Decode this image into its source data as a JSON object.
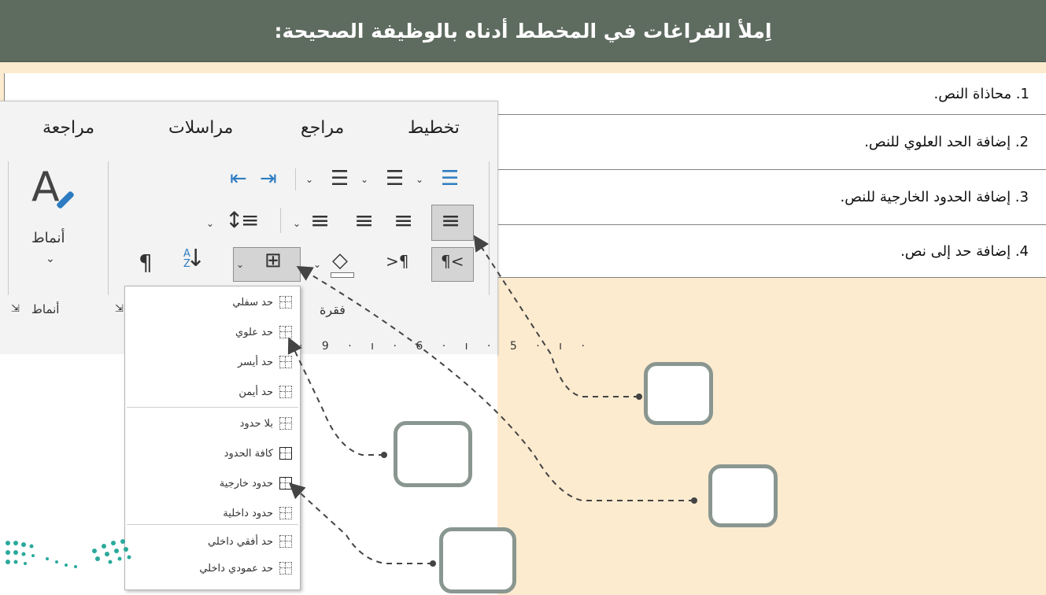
{
  "header": {
    "title": "اِملأ الفراغات في المخطط أدناه بالوظيفة الصحيحة:"
  },
  "items": [
    "1. محاذاة النص.",
    "2. إضافة الحد العلوي للنص.",
    "3. إضافة الحدود الخارجية للنص.",
    "4. إضافة حد إلى نص."
  ],
  "ribbon": {
    "tabs": [
      "تخطيط",
      "مراجع",
      "مراسلات",
      "مراجعة"
    ],
    "styles_label": "أنماط",
    "group_paragraph": "فقرة",
    "group_styles": "أنماط",
    "ruler": "· 9 · ı ·  6 · ı · 5 · ı ·"
  },
  "menu": {
    "items": [
      "حد سفلي",
      "حد علوي",
      "حد أيسر",
      "حد أيمن",
      "بلا حدود",
      "كافة الحدود",
      "حدود خارجية",
      "حدود داخلية",
      "حد أفقي داخلي",
      "حد عمودي داخلي"
    ]
  },
  "colors": {
    "header_bg": "#5e6b5f",
    "page_bg": "#fdebcf",
    "box_border": "#8a9690"
  }
}
